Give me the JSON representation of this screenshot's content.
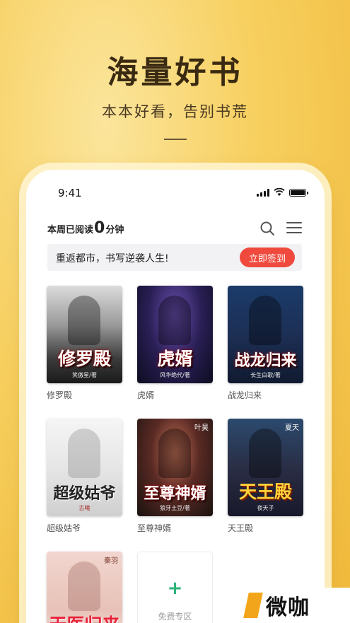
{
  "hero": {
    "title": "海量好书",
    "subtitle": "本本好看，告别书荒"
  },
  "status_bar": {
    "time": "9:41"
  },
  "header": {
    "reading_label": "本周已阅读",
    "reading_value": "0",
    "reading_unit": "分钟",
    "search_icon": "search-icon",
    "menu_icon": "menu-icon"
  },
  "banner": {
    "text": "重返都市，书写逆袭人生!",
    "button": "立即签到"
  },
  "books": [
    {
      "title": "修罗殿",
      "cover_title": "修罗殿",
      "cover_author": "笑傲星/著",
      "cover_tag": ""
    },
    {
      "title": "虎婿",
      "cover_title": "虎婿",
      "cover_author": "风华绝代/著",
      "cover_tag": ""
    },
    {
      "title": "战龙归来",
      "cover_title": "战龙归来",
      "cover_author": "长生白歌/著",
      "cover_tag": ""
    },
    {
      "title": "超级姑爷",
      "cover_title": "超级姑爷",
      "cover_author": "古曦",
      "cover_tag": ""
    },
    {
      "title": "至尊神婿",
      "cover_title": "至尊神婿",
      "cover_author": "狼牙土豆/著",
      "cover_tag": "叶昊"
    },
    {
      "title": "天王殿",
      "cover_title": "天王殿",
      "cover_author": "夜天子",
      "cover_tag": "夏天"
    },
    {
      "title": "",
      "cover_title": "天医归来",
      "cover_author": "",
      "cover_tag": "秦羽"
    }
  ],
  "free_zone": {
    "label": "免费专区",
    "icon": "plus-icon"
  },
  "watermark": {
    "text": "微咖"
  },
  "colors": {
    "accent": "#ef4a3d",
    "background": "#f7cf5e",
    "free_plus": "#2db37a"
  }
}
